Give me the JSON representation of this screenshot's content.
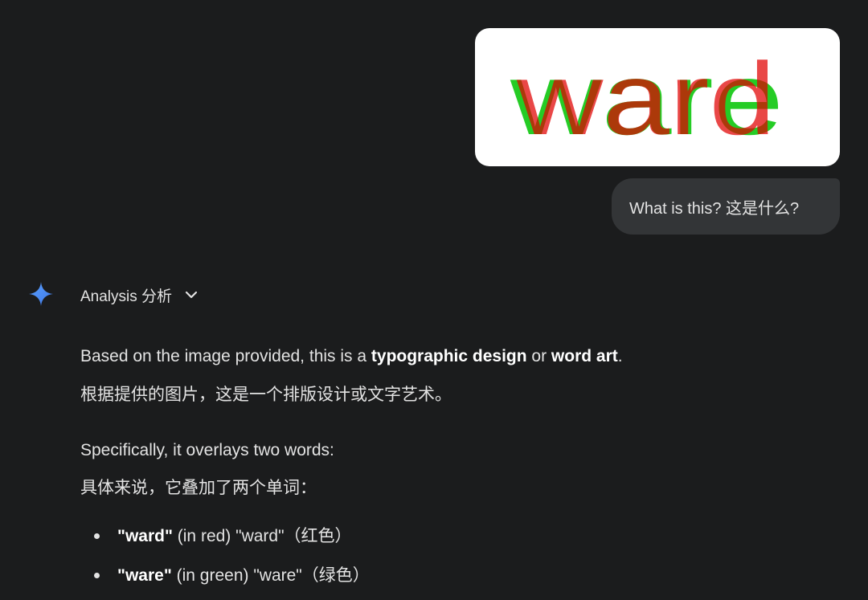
{
  "user_message": {
    "image": {
      "word_red": "ward",
      "word_green": "ware",
      "red_color": "#e00000",
      "green_color": "#12c812"
    },
    "text": "What is this?  这是什么?"
  },
  "response": {
    "analysis_label": "Analysis  分析",
    "p1": {
      "prefix": "Based on the image provided, this is a ",
      "bold1": "typographic design",
      "mid": " or ",
      "bold2": "word art",
      "suffix": "."
    },
    "p1_zh": "根据提供的图片，这是一个排版设计或文字艺术。",
    "p2": "Specifically, it overlays two words:",
    "p2_zh": "具体来说，它叠加了两个单词：",
    "bullets": [
      {
        "bold": "\"ward\"",
        "rest": " (in red)  \"ward\"（红色）"
      },
      {
        "bold": "\"ware\"",
        "rest": " (in green)  \"ware\"（绿色）"
      }
    ]
  },
  "colors": {
    "background": "#1b1c1d",
    "bubble": "#333537",
    "text": "#e3e3e3",
    "spark_blue": "#4c8df6"
  }
}
